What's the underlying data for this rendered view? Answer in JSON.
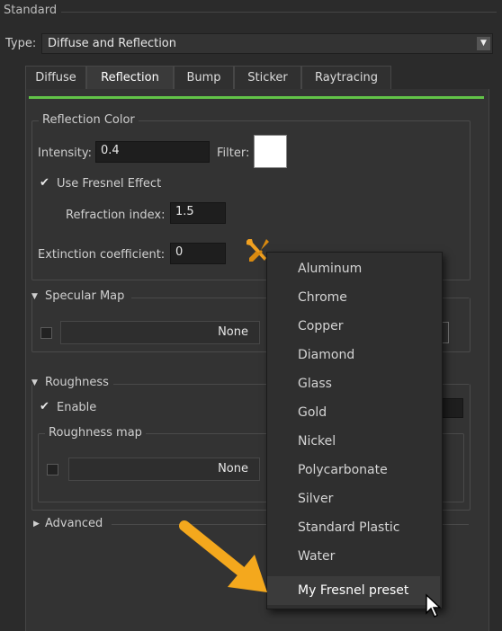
{
  "panel": {
    "title": "Standard"
  },
  "type_row": {
    "label": "Type:",
    "value": "Diffuse and Reflection"
  },
  "tabs": [
    "Diffuse",
    "Reflection",
    "Bump",
    "Sticker",
    "Raytracing"
  ],
  "active_tab": "Reflection",
  "reflection_color": {
    "legend": "Reflection Color",
    "intensity_label": "Intensity:",
    "intensity_value": "0.4",
    "filter_label": "Filter:",
    "filter_color": "#ffffff",
    "fresnel_label": "Use Fresnel Effect",
    "refraction_label": "Refraction index:",
    "refraction_value": "1.5",
    "extinction_label": "Extinction coefficient:",
    "extinction_value": "0"
  },
  "specular_map": {
    "legend": "Specular Map",
    "map_value": "None"
  },
  "roughness": {
    "legend": "Roughness",
    "enable_label": "Enable",
    "map_legend": "Roughness map",
    "map_value": "None"
  },
  "advanced": {
    "legend": "Advanced"
  },
  "preset_menu": {
    "items": [
      "Aluminum",
      "Chrome",
      "Copper",
      "Diamond",
      "Glass",
      "Gold",
      "Nickel",
      "Polycarbonate",
      "Silver",
      "Standard Plastic",
      "Water",
      "My Fresnel preset"
    ],
    "highlighted": "My Fresnel preset"
  },
  "colors": {
    "accent_line": "#62c348",
    "arrow": "#f4a81d",
    "wrench": "#f0a020"
  }
}
